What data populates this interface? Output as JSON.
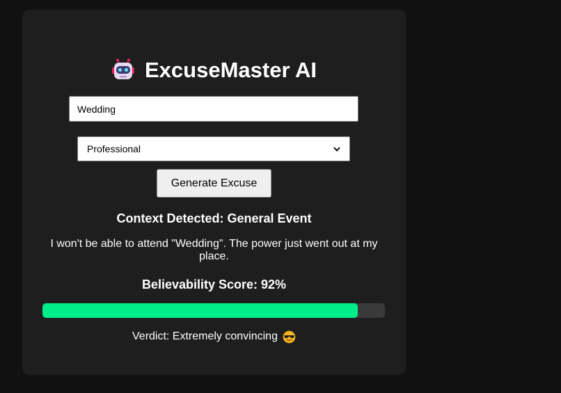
{
  "header": {
    "title": "ExcuseMaster AI",
    "icon": "robot-face-icon"
  },
  "form": {
    "event_input_value": "Wedding",
    "tone_selected": "Professional",
    "generate_label": "Generate Excuse"
  },
  "result": {
    "context_text": "Context Detected: General Event",
    "excuse_text": "I won't be able to attend \"Wedding\". The power just went out at my place.",
    "score_text": "Believability Score: 92%",
    "score_percent": 92,
    "verdict_text": "Verdict: Extremely convincing",
    "verdict_icon": "sunglasses-face-icon"
  },
  "colors": {
    "page_bg": "#111111",
    "card_bg": "#1e1e1e",
    "bar_fill": "#00ee8a",
    "bar_track": "#3a3a3a"
  }
}
